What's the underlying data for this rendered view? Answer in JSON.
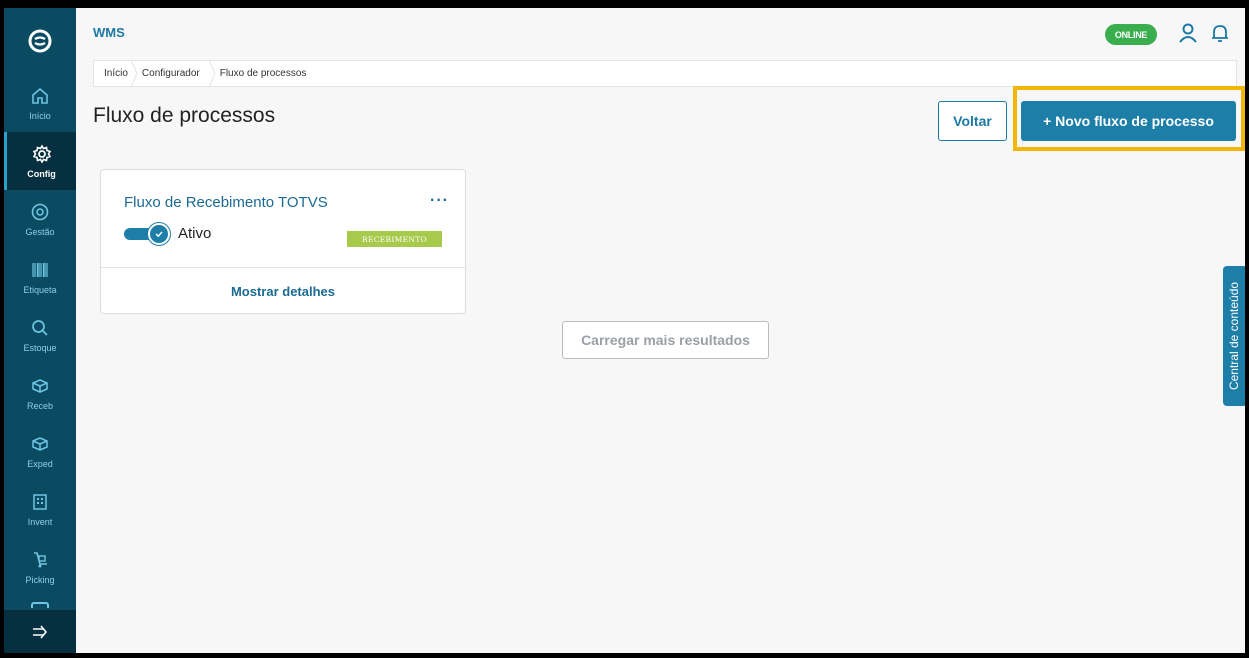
{
  "app": {
    "title": "WMS"
  },
  "header": {
    "status_badge": "ONLINE"
  },
  "sidebar": {
    "items": [
      {
        "label": "Início",
        "icon": "home-icon"
      },
      {
        "label": "Config",
        "icon": "gear-icon"
      },
      {
        "label": "Gestão",
        "icon": "target-icon"
      },
      {
        "label": "Etiqueta",
        "icon": "barcode-icon"
      },
      {
        "label": "Estoque",
        "icon": "search-icon"
      },
      {
        "label": "Receb",
        "icon": "box-icon"
      },
      {
        "label": "Exped",
        "icon": "box-icon"
      },
      {
        "label": "Invent",
        "icon": "building-icon"
      },
      {
        "label": "Picking",
        "icon": "hand-truck-icon"
      }
    ],
    "expand_icon": "expand-arrow-icon"
  },
  "breadcrumb": [
    "Início",
    "Configurador",
    "Fluxo de processos"
  ],
  "page": {
    "title": "Fluxo de processos",
    "back_label": "Voltar",
    "new_label": "+ Novo fluxo de processo"
  },
  "cards": [
    {
      "title": "Fluxo de Recebimento TOTVS",
      "menu": "···",
      "toggle_label": "Ativo",
      "active": true,
      "tag": "RECEBIMENTO",
      "details_label": "Mostrar detalhes"
    }
  ],
  "load_more_label": "Carregar mais resultados",
  "side_tab_label": "Central de conteúdo",
  "colors": {
    "sidebar": "#0b4b62",
    "primary": "#1d7ea8",
    "online": "#3aae4e",
    "highlight": "#f2b705",
    "tag": "#a7c94c"
  }
}
